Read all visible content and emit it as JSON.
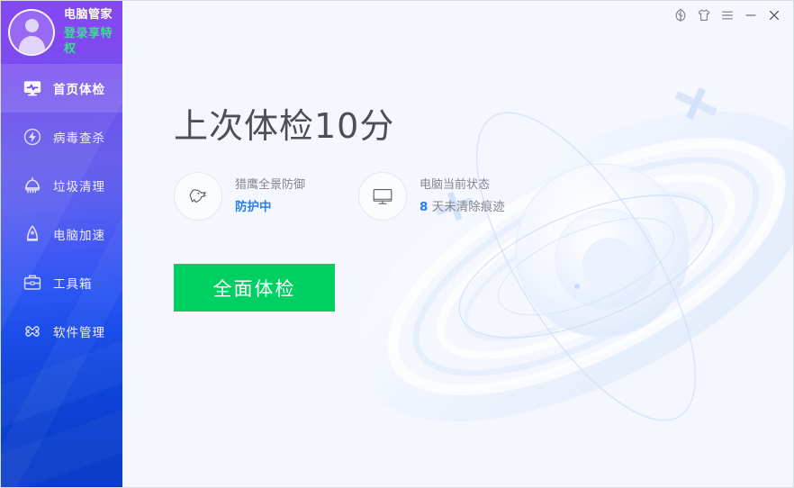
{
  "app": {
    "name": "电脑管家"
  },
  "sidebar": {
    "user": {
      "avatar_icon": "user-avatar-icon",
      "name": "电脑管家",
      "login_label": "登录享特权"
    },
    "items": [
      {
        "label": "首页体检",
        "icon": "monitor-pulse-icon",
        "active": true
      },
      {
        "label": "病毒查杀",
        "icon": "shield-bolt-icon",
        "active": false
      },
      {
        "label": "垃圾清理",
        "icon": "broom-icon",
        "active": false
      },
      {
        "label": "电脑加速",
        "icon": "rocket-icon",
        "active": false
      },
      {
        "label": "工具箱",
        "icon": "toolbox-icon",
        "active": false
      },
      {
        "label": "软件管理",
        "icon": "clover-icon",
        "active": false
      }
    ]
  },
  "titlebar": {
    "buttons": [
      {
        "name": "feedback-leaf-icon",
        "tip": "反馈"
      },
      {
        "name": "skin-shirt-icon",
        "tip": "换肤"
      },
      {
        "name": "menu-hamburger-icon",
        "tip": "菜单"
      },
      {
        "name": "minimize-icon",
        "tip": "最小化"
      },
      {
        "name": "close-icon",
        "tip": "关闭"
      }
    ]
  },
  "main": {
    "headline": "上次体检10分",
    "status": [
      {
        "icon": "eagle-head-icon",
        "title": "猎鹰全景防御",
        "value": "防护中",
        "value_style": "blue-strong"
      },
      {
        "icon": "monitor-icon",
        "title": "电脑当前状态",
        "value_num": "8",
        "value_rest": " 天未清除痕迹"
      }
    ],
    "cta_label": "全面体检"
  },
  "colors": {
    "sidebar_top": "#7b3df0",
    "sidebar_bottom": "#0b3cc6",
    "accent_green": "#00d061",
    "login_green": "#39e08a",
    "accent_blue": "#2b7ef0",
    "main_bg": "#f4f7fd",
    "headline_gray": "#4a4f58"
  }
}
